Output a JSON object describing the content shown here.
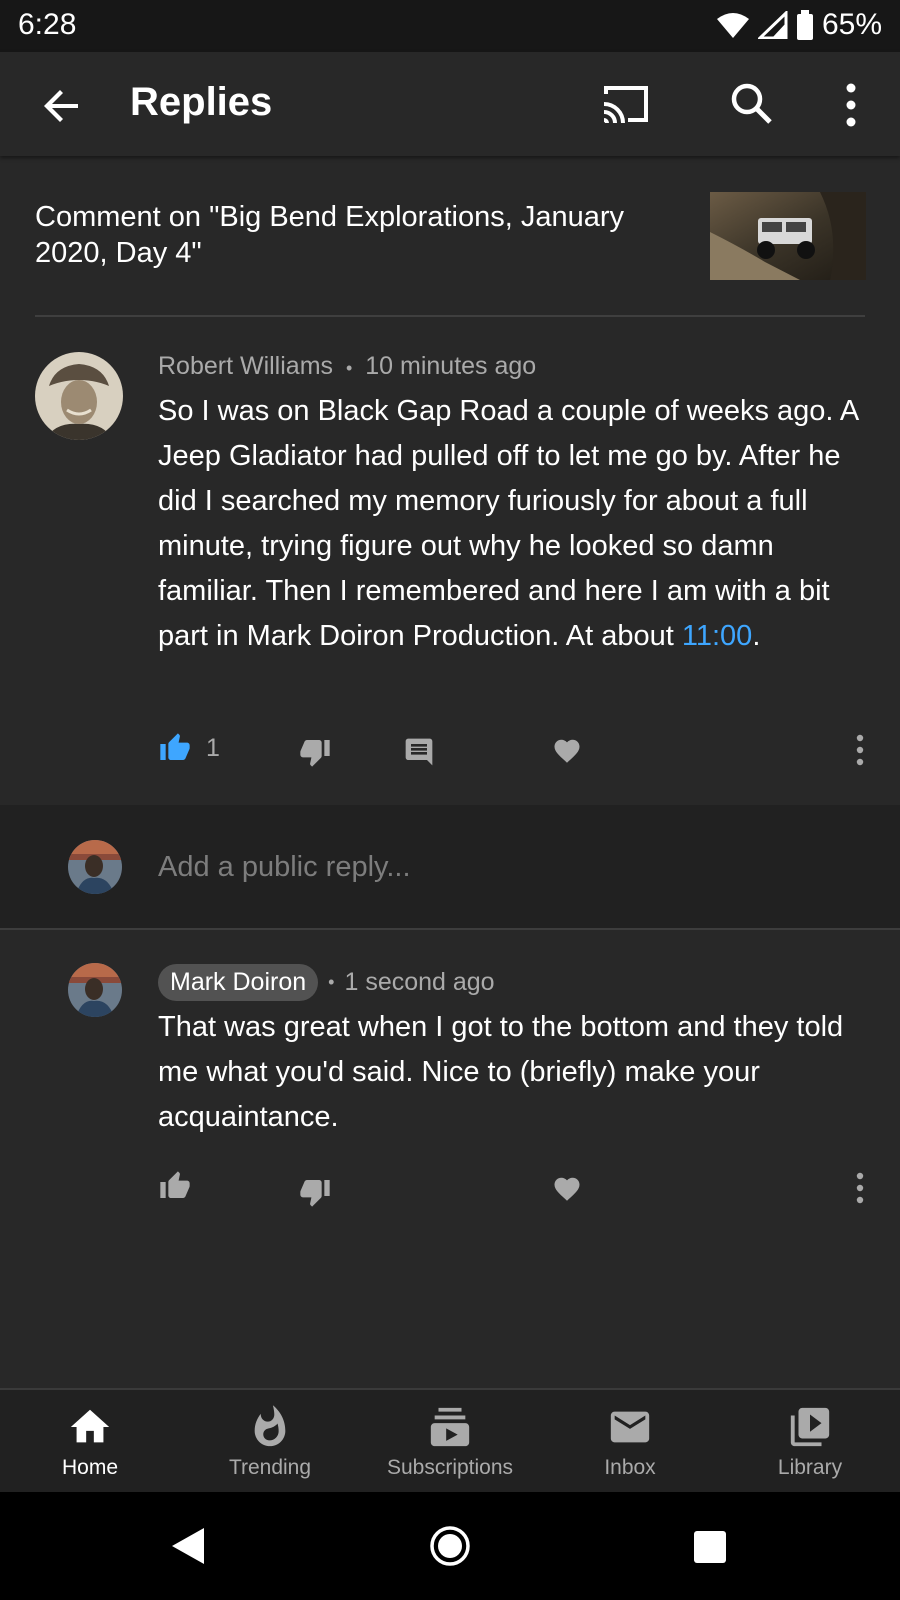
{
  "status_bar": {
    "time": "6:28",
    "battery": "65%"
  },
  "app_bar": {
    "title": "Replies"
  },
  "video": {
    "comment_on": "Comment on \"Big Bend Explorations, January 2020, Day 4\""
  },
  "comment": {
    "author": "Robert Williams",
    "separator": "•",
    "time": "10 minutes ago",
    "text": "So I was on Black Gap Road a couple of weeks ago.   A Jeep Gladiator had pulled off to let me go by.  After he did I searched my memory furiously for about a full minute, trying figure out why he looked so damn familiar. Then I remembered and here I am with a bit part in  Mark Doiron Production.  At about ",
    "timestamp": "11:00",
    "text_end": ".",
    "like_count": "1",
    "like_color": "#3ea6ff"
  },
  "reply_input": {
    "placeholder": "Add a public reply..."
  },
  "reply": {
    "author": "Mark Doiron",
    "separator": "•",
    "time": "1 second ago",
    "text": "That was great when I got to the bottom and they told me what you'd said.  Nice to (briefly) make your acquaintance."
  },
  "bottom_nav": {
    "items": [
      {
        "label": "Home",
        "icon": "home-icon",
        "active": true
      },
      {
        "label": "Trending",
        "icon": "flame-icon",
        "active": false
      },
      {
        "label": "Subscriptions",
        "icon": "subscriptions-icon",
        "active": false
      },
      {
        "label": "Inbox",
        "icon": "mail-icon",
        "active": false
      },
      {
        "label": "Library",
        "icon": "library-icon",
        "active": false
      }
    ]
  }
}
